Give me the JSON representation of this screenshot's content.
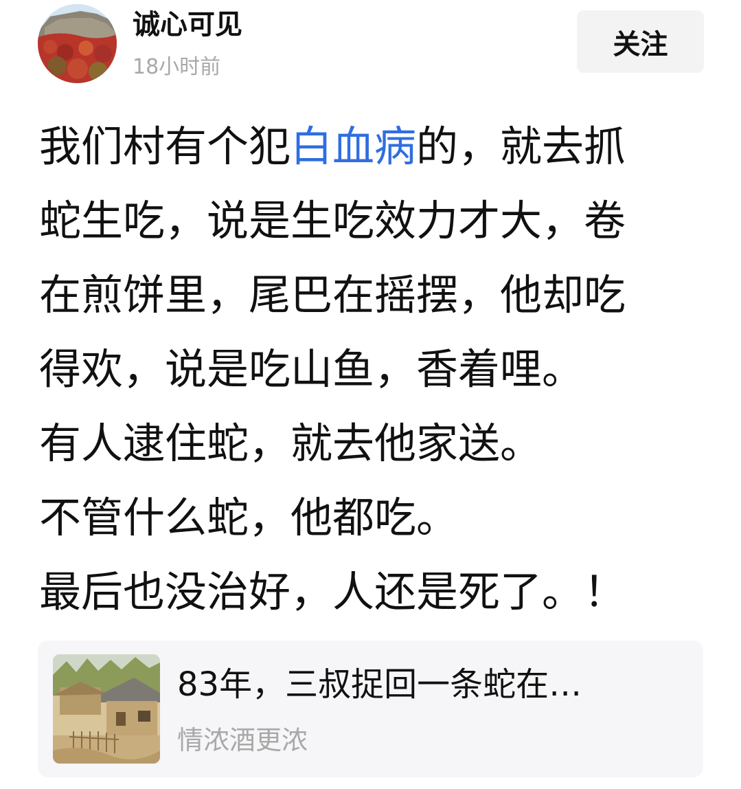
{
  "post": {
    "author": {
      "name": "诚心可见",
      "time": "18小时前"
    },
    "follow_label": "关注",
    "body": {
      "line1_before": "我们村有个犯",
      "line1_link": "白血病",
      "line1_after": "的，就去抓",
      "line2": "蛇生吃，说是生吃效力才大，卷",
      "line3": "在煎饼里，尾巴在摇摆，他却吃",
      "line4": "得欢，说是吃山鱼，香着哩。",
      "line5": "有人逮住蛇，就去他家送。",
      "line6": "不管什么蛇，他都吃。",
      "line7": "最后也没治好，人还是死了。！"
    },
    "link_color": "#2f6ee0"
  },
  "article_card": {
    "title": "83年，三叔捉回一条蛇在…",
    "source": "情浓酒更浓"
  }
}
